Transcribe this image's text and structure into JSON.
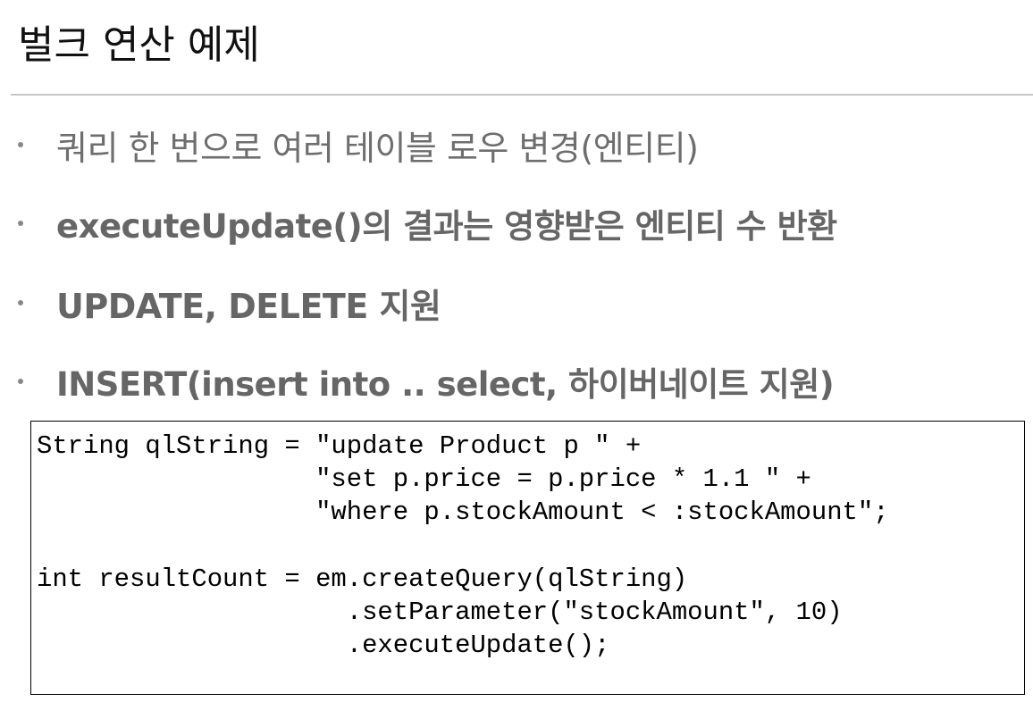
{
  "slide": {
    "title": "벌크 연산 예제"
  },
  "bullets": [
    "쿼리 한 번으로 여러 테이블 로우 변경(엔티티)",
    "executeUpdate()의 결과는 영향받은 엔티티 수 반환",
    "UPDATE, DELETE 지원",
    "INSERT(insert into .. select, 하이버네이트 지원)"
  ],
  "code": {
    "lines": [
      "String qlString = \"update Product p \" +",
      "                  \"set p.price = p.price * 1.1 \" +",
      "                  \"where p.stockAmount < :stockAmount\";",
      "",
      "int resultCount = em.createQuery(qlString)",
      "                    .setParameter(\"stockAmount\", 10)",
      "                    .executeUpdate();"
    ]
  }
}
